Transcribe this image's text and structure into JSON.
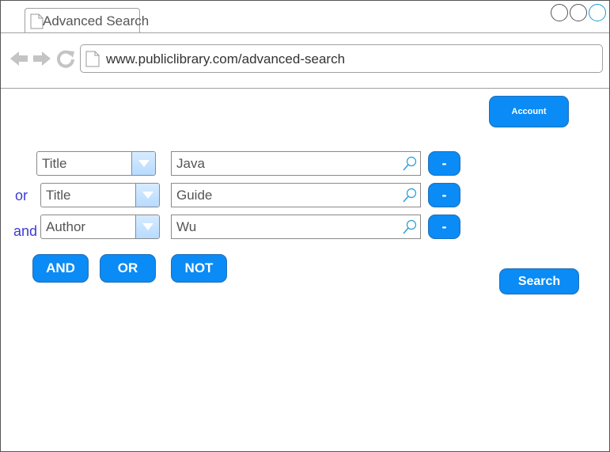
{
  "browser": {
    "tab_title": "Advanced Search",
    "url": "www.publiclibrary.com/advanced-search"
  },
  "header": {
    "account_label": "Account"
  },
  "criteria": [
    {
      "connector": "",
      "field": "Title",
      "term": "Java",
      "remove_label": "-"
    },
    {
      "connector": "or",
      "field": "Title",
      "term": "Guide",
      "remove_label": "-"
    },
    {
      "connector": "and",
      "field": "Author",
      "term": "Wu",
      "remove_label": "-"
    }
  ],
  "operators": {
    "and_label": "AND",
    "or_label": "OR",
    "not_label": "NOT"
  },
  "search_label": "Search",
  "colors": {
    "accent": "#0a8bf5",
    "connector_text": "#3b3bd6"
  }
}
